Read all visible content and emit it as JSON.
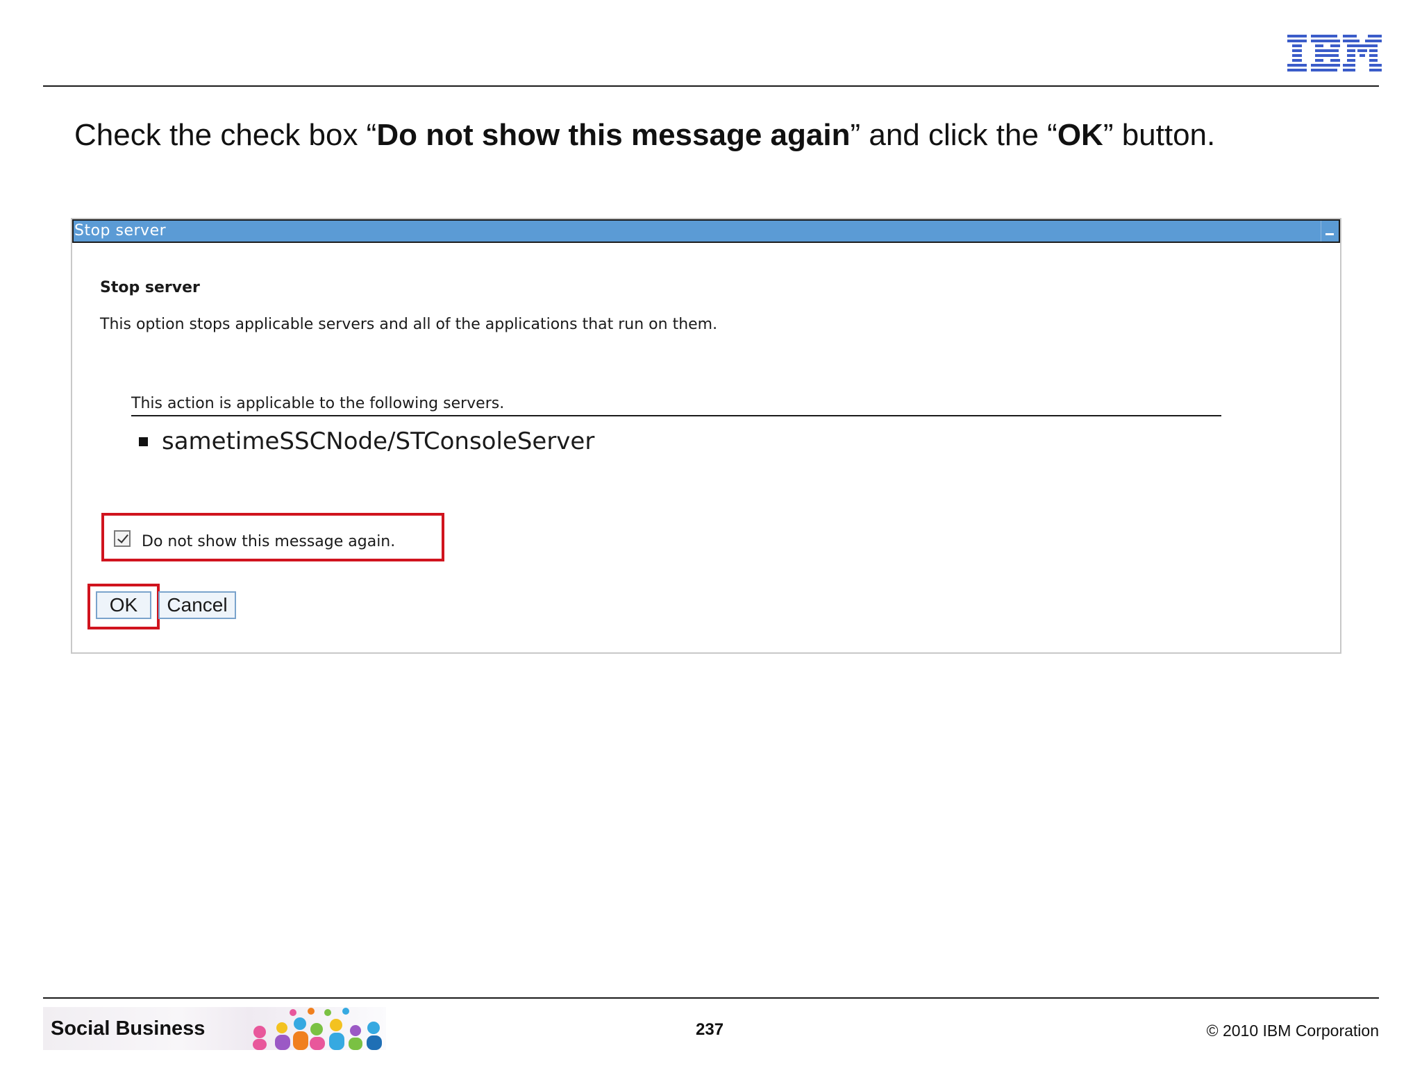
{
  "header": {
    "logo_text": "IBM"
  },
  "instruction": {
    "part1": "Check the check box “",
    "bold1": "Do not show this message again",
    "part2": "” and click the “",
    "bold2": "OK",
    "part3": "” button."
  },
  "dialog": {
    "title": "Stop server",
    "heading": "Stop server",
    "description": "This option stops applicable servers and all of the applications that run on them.",
    "applicable_label": "This action is applicable to the following servers.",
    "servers": [
      "sametimeSSCNode/STConsoleServer"
    ],
    "checkbox_label": "Do not show this message again.",
    "checkbox_checked": true,
    "ok_label": "OK",
    "cancel_label": "Cancel"
  },
  "footer": {
    "brand": "Social Business",
    "page_number": "237",
    "copyright": "© 2010 IBM Corporation"
  },
  "colors": {
    "titlebar": "#5b9bd5",
    "highlight": "#d0141e",
    "ibm_blue": "#3b5cc9"
  }
}
